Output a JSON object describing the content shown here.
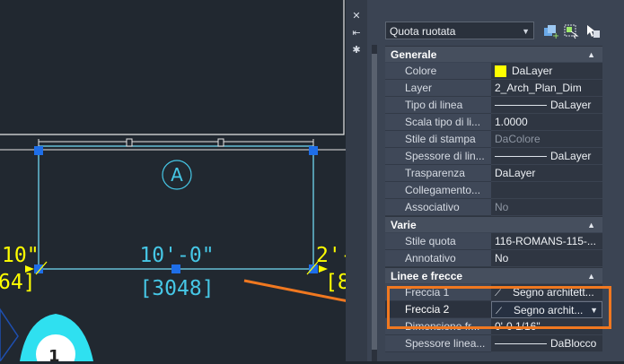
{
  "palette": {
    "object_type": "Quota ruotata",
    "sections": [
      {
        "title": "Generale",
        "rows": [
          {
            "label": "Colore",
            "value": "DaLayer"
          },
          {
            "label": "Layer",
            "value": "2_Arch_Plan_Dim"
          },
          {
            "label": "Tipo di linea",
            "value": "DaLayer"
          },
          {
            "label": "Scala tipo di li...",
            "value": "1.0000"
          },
          {
            "label": "Stile di stampa",
            "value": "DaColore"
          },
          {
            "label": "Spessore di lin...",
            "value": "DaLayer"
          },
          {
            "label": "Trasparenza",
            "value": "DaLayer"
          },
          {
            "label": "Collegamento...",
            "value": ""
          },
          {
            "label": "Associativo",
            "value": "No"
          }
        ]
      },
      {
        "title": "Varie",
        "rows": [
          {
            "label": "Stile quota",
            "value": "116-ROMANS-115-..."
          },
          {
            "label": "Annotativo",
            "value": "No"
          }
        ]
      },
      {
        "title": "Linee e frecce",
        "rows": [
          {
            "label": "Freccia 1",
            "value": "Segno architett..."
          },
          {
            "label": "Freccia 2",
            "value": "Segno archit..."
          },
          {
            "label": "Dimensione fr...",
            "value": "0'-0 1/16\""
          },
          {
            "label": "Spessore linea...",
            "value": "DaBlocco"
          }
        ]
      }
    ]
  },
  "drawing": {
    "grip_label": "A",
    "dim_imperial": "10'-0\"",
    "dim_metric": "[3048]",
    "left_imperial": "10\"",
    "left_metric": "64]",
    "right_imperial": "2'-",
    "right_metric": "[8",
    "marker": "1"
  },
  "colors": {
    "canvas": "#212830",
    "palette": "#3b4453",
    "dimension": "#46c7e6",
    "highlight": "#f07820",
    "grip": "#1e6ee8",
    "yellow": "#ffff00"
  },
  "icons": [
    "close-icon",
    "pin-icon",
    "settings-icon",
    "quick-select-icon",
    "select-objects-icon",
    "toggle-pickadd-icon"
  ]
}
